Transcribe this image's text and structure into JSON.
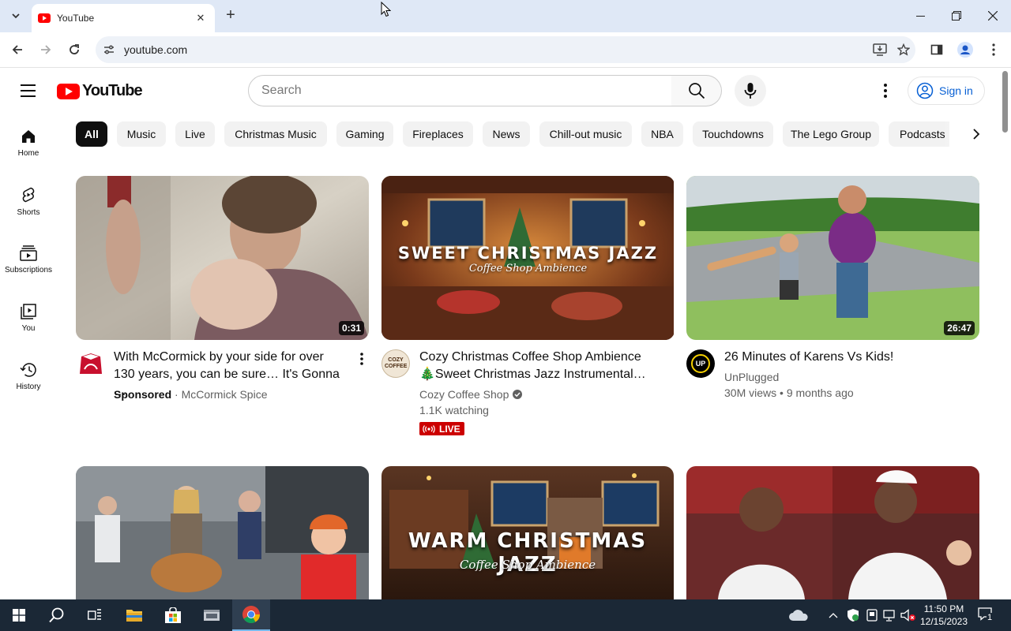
{
  "browser": {
    "tab_title": "YouTube",
    "url": "youtube.com",
    "new_tab_label": "+",
    "colors": {
      "titlebar": "#dfe8f6",
      "omnibox": "#eef2f8"
    }
  },
  "youtube": {
    "logo_text": "YouTube",
    "search_placeholder": "Search",
    "sign_in_label": "Sign in",
    "guide": [
      {
        "label": "Home",
        "icon": "home-icon"
      },
      {
        "label": "Shorts",
        "icon": "shorts-icon"
      },
      {
        "label": "Subscriptions",
        "icon": "subscriptions-icon"
      },
      {
        "label": "You",
        "icon": "you-icon"
      },
      {
        "label": "History",
        "icon": "history-icon"
      }
    ],
    "chips": [
      "All",
      "Music",
      "Live",
      "Christmas Music",
      "Gaming",
      "Fireplaces",
      "News",
      "Chill-out music",
      "NBA",
      "Touchdowns",
      "The Lego Group",
      "Podcasts"
    ],
    "videos": [
      {
        "title": "With McCormick by your side for over 130 years, you can be sure… It's Gonna …",
        "channel": "McCormick Spice",
        "sponsored_label": "Sponsored",
        "separator": "·",
        "duration": "0:31"
      },
      {
        "title": "Cozy Christmas Coffee Shop Ambience 🎄Sweet Christmas Jazz Instrumental…",
        "channel": "Cozy Coffee Shop",
        "viewers": "1.1K watching",
        "live_label": "LIVE",
        "thumb_big": "SWEET CHRISTMAS JAZZ",
        "thumb_small": "Coffee Shop Ambience",
        "avatar_text": "COZY COFFEE"
      },
      {
        "title": "26 Minutes of Karens Vs Kids!",
        "channel": "UnPlugged",
        "views": "30M views",
        "age": "9 months ago",
        "separator": "•",
        "duration": "26:47",
        "avatar_text": "UP"
      },
      {
        "title": ""
      },
      {
        "thumb_big": "WARM CHRISTMAS JAZZ",
        "thumb_small": "Coffee Shop Ambience"
      },
      {
        "title": ""
      }
    ]
  },
  "taskbar": {
    "time": "11:50 PM",
    "date": "12/15/2023",
    "notification_count": "1"
  }
}
